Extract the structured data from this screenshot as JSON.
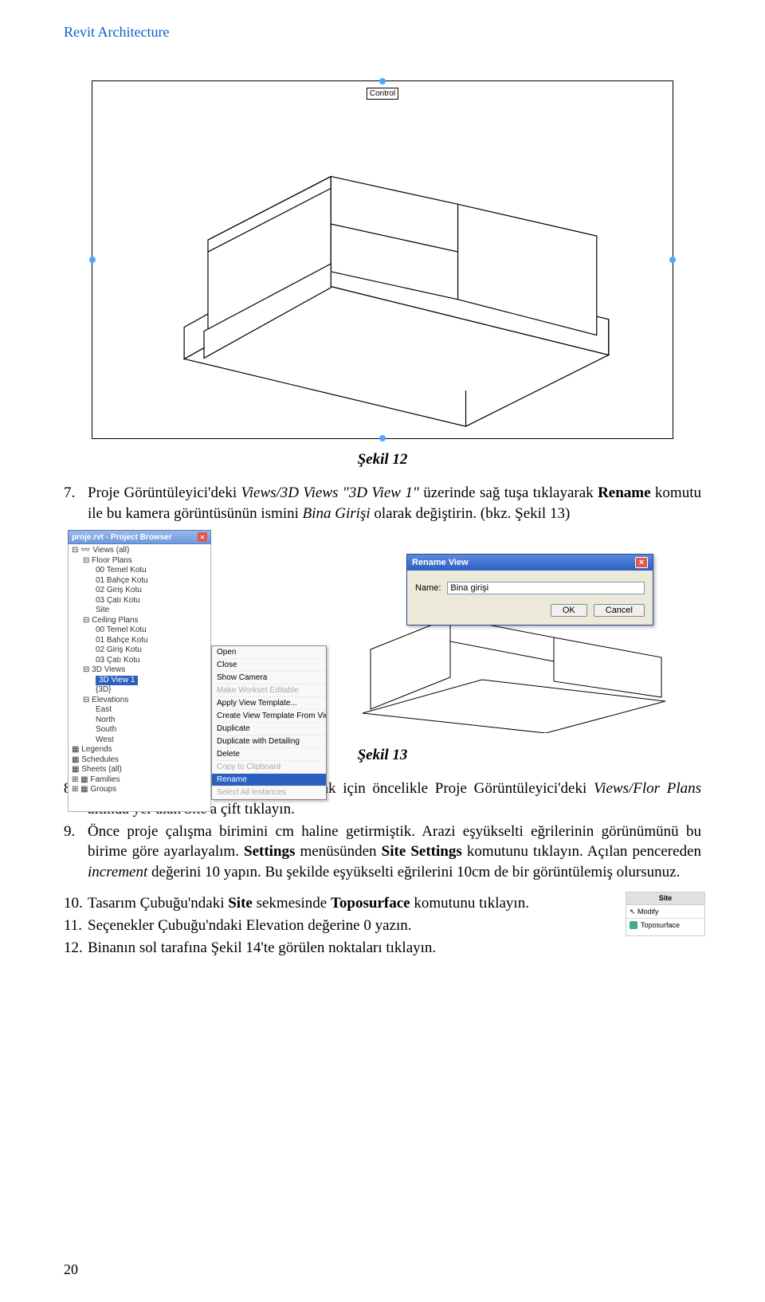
{
  "header": "Revit Architecture",
  "figure12": {
    "control_label": "Control",
    "caption": "Şekil 12"
  },
  "item7": {
    "num": "7.",
    "text_a": "Proje Görüntüleyici'deki ",
    "views_path": "Views/3D Views \"3D View 1\"",
    "text_b": " üzerinde sağ tuşa tıklayarak ",
    "rename": "Rename",
    "text_c": " komutu ile bu kamera görüntüsünün ismini ",
    "bina": "Bina Girişi",
    "text_d": " olarak değiştirin. (bkz. Şekil 13)"
  },
  "figure13": {
    "caption": "Şekil 13",
    "browser_title": "proje.rvt - Project Browser",
    "tree": {
      "views": "Views (all)",
      "floor_plans": "Floor Plans",
      "fp": [
        "00 Temel Kotu",
        "01 Bahçe Kotu",
        "02 Giriş Kotu",
        "03 Çatı Kotu",
        "Site"
      ],
      "ceiling_plans": "Ceiling Plans",
      "cp": [
        "00 Temel Kotu",
        "01 Bahçe Kotu",
        "02 Giriş Kotu",
        "03 Çatı Kotu"
      ],
      "views3d": "3D Views",
      "views3d_items": [
        "3D View 1",
        "{3D}"
      ],
      "elevations": "Elevations",
      "elev_items": [
        "East",
        "North",
        "South",
        "West"
      ],
      "legends": "Legends",
      "schedules": "Schedules",
      "sheets": "Sheets (all)",
      "families": "Families",
      "groups": "Groups"
    },
    "context_menu": [
      "Open",
      "Close",
      "Show Camera",
      "Make Workset Editable",
      "Apply View Template...",
      "Create View Template From View...",
      "Duplicate",
      "Duplicate with Detailing",
      "Delete",
      "Copy to Clipboard",
      "Rename",
      "Select All Instances"
    ],
    "dialog": {
      "title": "Rename View",
      "name_label": "Name:",
      "name_value": "Bina girişi",
      "ok": "OK",
      "cancel": "Cancel"
    }
  },
  "item8": {
    "num": "8.",
    "text_a": "Artık eğimli bir arazi yüzeyi yaratmak için öncelikle Proje Görüntüleyici'deki ",
    "views": "Views/Flor Plans",
    "text_b": " altında yer alan ",
    "site": "Site",
    "text_c": "'a çift tıklayın."
  },
  "item9": {
    "num": "9.",
    "text_a": "Önce proje çalışma birimini cm haline getirmiştik. Arazi eşyükselti eğrilerinin görünümünü bu birime göre ayarlayalım. ",
    "settings": "Settings",
    "text_b": " menüsünden ",
    "sitesettings": "Site Settings",
    "text_c": " komutunu tıklayın. Açılan pencereden ",
    "increment": "increment",
    "text_d": " değerini 10 yapın. Bu şekilde eşyükselti eğrilerini 10cm de bir görüntülemiş olursunuz."
  },
  "item10": {
    "num": "10.",
    "text_a": "Tasarım Çubuğu'ndaki ",
    "site": "Site",
    "text_b": " sekmesinde ",
    "topo": "Toposurface",
    "text_c": " komutunu tıklayın."
  },
  "inline_panel": {
    "header": "Site",
    "modify": "Modify",
    "toposurface": "Toposurface"
  },
  "item11": {
    "num": "11.",
    "text": "Seçenekler Çubuğu'ndaki Elevation değerine 0 yazın."
  },
  "item12": {
    "num": "12.",
    "text": "Binanın sol tarafına Şekil 14'te görülen noktaları tıklayın."
  },
  "page_number": "20"
}
